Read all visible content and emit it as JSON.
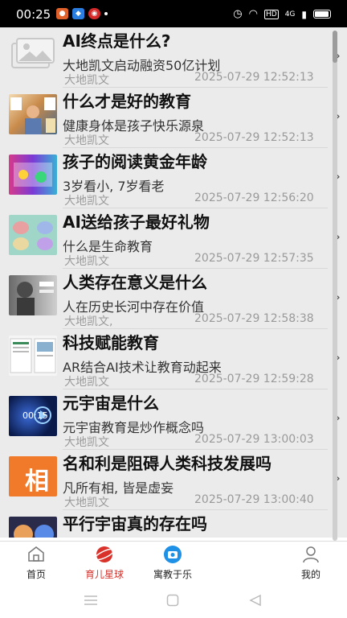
{
  "status": {
    "time": "00:25",
    "network_labels": [
      "HD",
      "4G"
    ]
  },
  "items": [
    {
      "title": "AI终点是什么?",
      "subtitle": "大地凯文启动融资50亿计划",
      "author": "大地凯文",
      "date": "2025-07-29 12:52:13",
      "thumb": "placeholder-image"
    },
    {
      "title": "什么才是好的教育",
      "subtitle": "健康身体是孩子快乐源泉",
      "author": "大地凯文",
      "date": "2025-07-29 12:52:13",
      "thumb": "animal-cards"
    },
    {
      "title": "孩子的阅读黄金年龄",
      "subtitle": "3岁看小, 7岁看老",
      "author": "大地凯文",
      "date": "2025-07-29 12:56:20",
      "thumb": "colorful-book"
    },
    {
      "title": "AI送给孩子最好礼物",
      "subtitle": "什么是生命教育",
      "author": "大地凯文",
      "date": "2025-07-29 12:57:35",
      "thumb": "brain-chart"
    },
    {
      "title": "人类存在意义是什么",
      "subtitle": "人在历史长河中存在价值",
      "author": "大地凯文,",
      "date": "2025-07-29 12:58:38",
      "thumb": "statue"
    },
    {
      "title": "科技赋能教育",
      "subtitle": "AR结合AI技术让教育动起来",
      "author": "大地凯文",
      "date": "2025-07-29 12:59:28",
      "thumb": "document-pages"
    },
    {
      "title": "元宇宙是什么",
      "subtitle": "元宇宙教育是炒作概念吗",
      "author": "大地凯文",
      "date": "2025-07-29 13:00:03",
      "thumb": "video-thumb",
      "video_time": "00:15"
    },
    {
      "title": "名和利是阻碍人类科技发展吗",
      "subtitle": "凡所有相, 皆是虚妄",
      "author": "大地凯文",
      "date": "2025-07-29 13:00:40",
      "thumb": "calligraphy",
      "thumb_char": "相"
    },
    {
      "title": "平行宇宙真的存在吗",
      "subtitle": "",
      "author": "",
      "date": "",
      "thumb": "planet"
    }
  ],
  "tabs": [
    {
      "label": "首页",
      "icon": "home-icon"
    },
    {
      "label": "育儿星球",
      "icon": "planet-icon"
    },
    {
      "label": "寓教于乐",
      "icon": "camera-icon"
    },
    {
      "label": "我的",
      "icon": "user-icon"
    }
  ],
  "colors": {
    "accent": "#d9322b",
    "camera": "#1e90e6"
  }
}
